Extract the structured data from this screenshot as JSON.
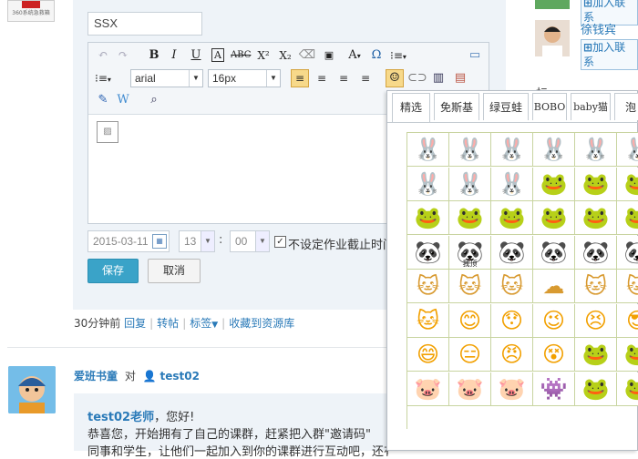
{
  "sidebar_logo_text": "360系统急救箱",
  "editor": {
    "title_value": "SSX",
    "font_family": "arial",
    "font_size": "16px",
    "image_placeholder": "▨"
  },
  "deadline": {
    "date": "2015-03-11",
    "hour": "13",
    "minute": "00",
    "colon": ":",
    "no_deadline_label": "不设定作业截止时间"
  },
  "buttons": {
    "save": "保存",
    "cancel": "取消"
  },
  "post_meta": {
    "time": "30分钟前",
    "reply": "回复",
    "repost": "转帖",
    "tags": "标签",
    "collect": "收藏到资源库"
  },
  "post": {
    "author": "爱班书童",
    "to_word": "对",
    "recipient": "test02",
    "greeting_name": "test02老师",
    "greeting_rest": "，您好!",
    "line1": "恭喜您，开始拥有了自己的课群，赶紧把入群\"邀请码\"",
    "line2": "同事和学生，让他们一起加入到你的课群进行互动吧，还有，你刚在就"
  },
  "right_col": {
    "join_label_1": "加入联系",
    "user_name": "徐钱宾",
    "join_label_2": "加入联系",
    "partial_heading": "标"
  },
  "emoticon_panel": {
    "tabs": [
      "精选",
      "免斯基",
      "绿豆蛙",
      "BOBO",
      "baby猫",
      "泡"
    ],
    "active_tab": "精选",
    "rows": [
      [
        "🐰",
        "🐰",
        "🐰",
        "🐰",
        "🐰",
        "🐰"
      ],
      [
        "🐰",
        "🐰",
        "🐰",
        "🐸",
        "🐸",
        "🐸"
      ],
      [
        "🐸",
        "🐸",
        "🐸",
        "🐸",
        "🐸",
        "🐸"
      ],
      [
        "🐼",
        "🐼",
        "🐼",
        "🐼",
        "🐼",
        "🐼"
      ],
      [
        "🐱",
        "🐱",
        "🐱",
        "☁",
        "🐱",
        "🐱"
      ],
      [
        "🐱",
        "😊",
        "😯",
        "😉",
        "😣",
        "😎"
      ],
      [
        "😄",
        "😑",
        "😠",
        "😵",
        "🐸",
        "🐸"
      ],
      [
        "🐷",
        "🐷",
        "🐷",
        "👾",
        "🐸",
        "🐸"
      ]
    ],
    "row_colors": [
      "#000000",
      "#000000",
      "#2da530",
      "#111111",
      "#d89a30",
      "#f2a000",
      "#f2a000",
      "#e0508a"
    ],
    "tag_text": "我顶"
  },
  "colors": {
    "accent": "#3aa3c8",
    "link": "#2a7ab8",
    "panel_bg": "#eef3f8"
  }
}
